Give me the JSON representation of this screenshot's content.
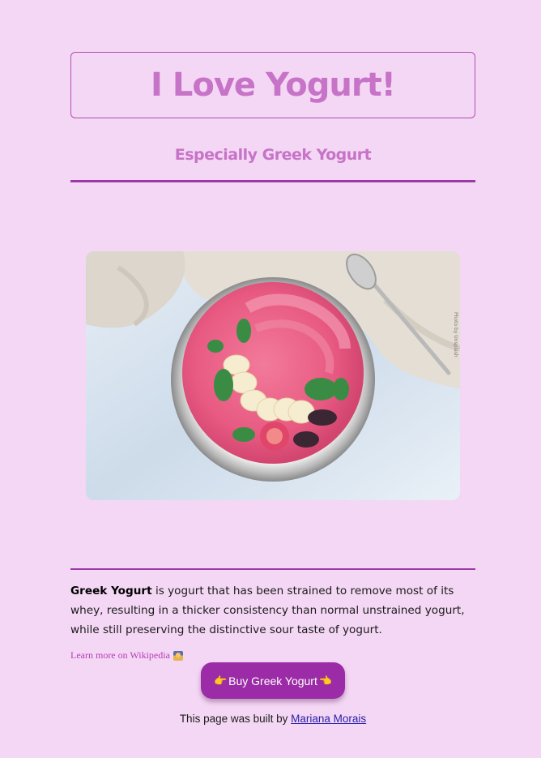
{
  "header": {
    "title": "I Love Yogurt!",
    "subtitle": "Especially Greek Yogurt"
  },
  "hero": {
    "image_alt": "Pink smoothie bowl with banana, mint, berries and coconut",
    "photo_credit": "Photo by Unsplash"
  },
  "content": {
    "term": "Greek Yogurt",
    "description": " is yogurt that has been strained to remove most of its whey, resulting in a thicker consistency than normal unstrained yogurt, while still preserving the distinctive sour taste of yogurt.",
    "wiki_link_label": "Learn more on Wikipedia",
    "wiki_icon": "sunrise-emoji-icon"
  },
  "cta": {
    "label": "Buy Greek Yogurt",
    "left_icon": "pointing-right-hand-icon",
    "right_icon": "pointing-left-hand-icon"
  },
  "footer": {
    "prefix": "This page was built by ",
    "author": "Mariana Morais"
  },
  "colors": {
    "background": "#f4d7f4",
    "accent": "#c773c7",
    "button": "#9b2ba6",
    "divider": "#9b3aa6",
    "link": "#2b20a8"
  }
}
